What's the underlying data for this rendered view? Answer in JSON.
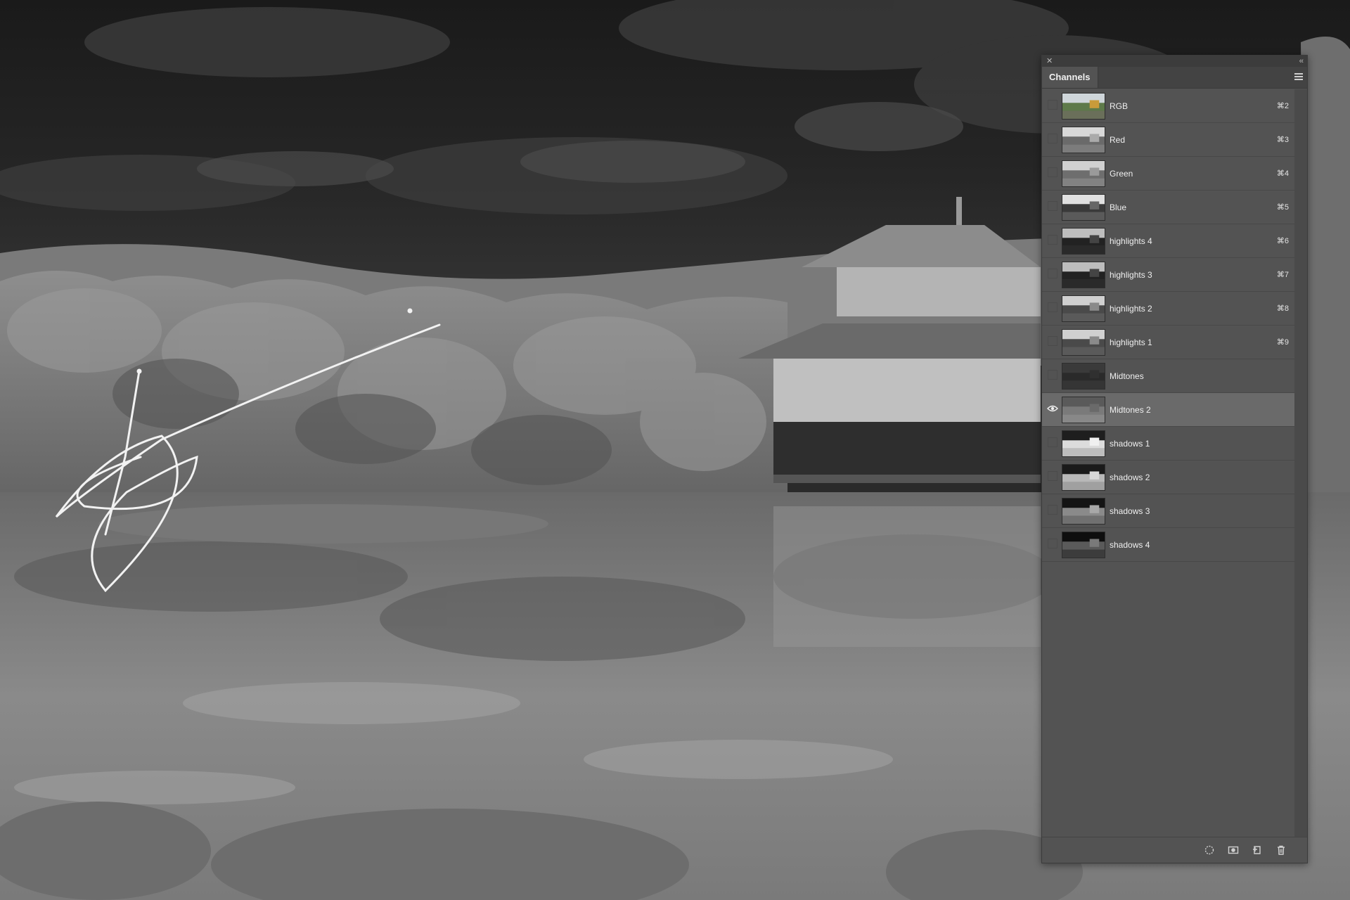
{
  "panel": {
    "close_glyph": "✕",
    "collapse_glyph": "‹‹",
    "tab_label": "Channels",
    "menu_icon": "hamburger-menu-icon"
  },
  "channels": [
    {
      "name": "RGB",
      "shortcut": "⌘2",
      "visible": false,
      "selected": false,
      "thumb": "rgb"
    },
    {
      "name": "Red",
      "shortcut": "⌘3",
      "visible": false,
      "selected": false,
      "thumb": "red"
    },
    {
      "name": "Green",
      "shortcut": "⌘4",
      "visible": false,
      "selected": false,
      "thumb": "green"
    },
    {
      "name": "Blue",
      "shortcut": "⌘5",
      "visible": false,
      "selected": false,
      "thumb": "blue"
    },
    {
      "name": "highlights 4",
      "shortcut": "⌘6",
      "visible": false,
      "selected": false,
      "thumb": "dark"
    },
    {
      "name": "highlights 3",
      "shortcut": "⌘7",
      "visible": false,
      "selected": false,
      "thumb": "dark"
    },
    {
      "name": "highlights 2",
      "shortcut": "⌘8",
      "visible": false,
      "selected": false,
      "thumb": "mid"
    },
    {
      "name": "highlights 1",
      "shortcut": "⌘9",
      "visible": false,
      "selected": false,
      "thumb": "mid"
    },
    {
      "name": "Midtones",
      "shortcut": "",
      "visible": false,
      "selected": false,
      "thumb": "darkflat"
    },
    {
      "name": "Midtones 2",
      "shortcut": "",
      "visible": true,
      "selected": true,
      "thumb": "midflat"
    },
    {
      "name": "shadows 1",
      "shortcut": "",
      "visible": false,
      "selected": false,
      "thumb": "light"
    },
    {
      "name": "shadows 2",
      "shortcut": "",
      "visible": false,
      "selected": false,
      "thumb": "light2"
    },
    {
      "name": "shadows 3",
      "shortcut": "",
      "visible": false,
      "selected": false,
      "thumb": "darkish"
    },
    {
      "name": "shadows 4",
      "shortcut": "",
      "visible": false,
      "selected": false,
      "thumb": "darker"
    }
  ],
  "bottom_icons": [
    "load-channel-selection-icon",
    "save-selection-icon",
    "new-channel-icon",
    "trash-icon"
  ],
  "colors": {
    "panel_bg": "#535353",
    "selected_row": "#6a6a6a",
    "text": "#efefef"
  }
}
